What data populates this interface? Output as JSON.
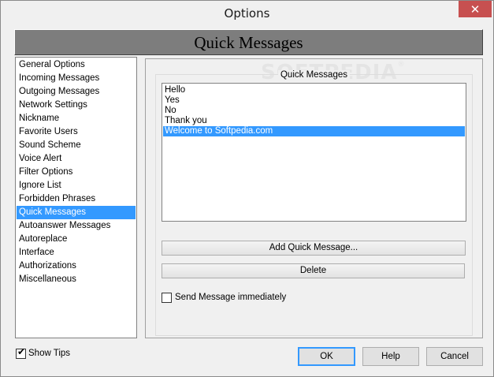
{
  "window": {
    "title": "Options",
    "close_glyph": "✕"
  },
  "header": {
    "title": "Quick Messages"
  },
  "watermark": {
    "text": "SOFTPEDIA",
    "mark": "®"
  },
  "nav": {
    "items": [
      {
        "label": "General Options"
      },
      {
        "label": "Incoming Messages"
      },
      {
        "label": "Outgoing Messages"
      },
      {
        "label": "Network Settings"
      },
      {
        "label": "Nickname"
      },
      {
        "label": "Favorite Users"
      },
      {
        "label": "Sound Scheme"
      },
      {
        "label": "Voice Alert"
      },
      {
        "label": "Filter Options"
      },
      {
        "label": "Ignore List"
      },
      {
        "label": "Forbidden Phrases"
      },
      {
        "label": "Quick Messages",
        "selected": true
      },
      {
        "label": "Autoanswer Messages"
      },
      {
        "label": "Autoreplace"
      },
      {
        "label": "Interface"
      },
      {
        "label": "Authorizations"
      },
      {
        "label": "Miscellaneous"
      }
    ]
  },
  "quick_messages": {
    "group_label": "Quick Messages",
    "messages": [
      {
        "text": "Hello"
      },
      {
        "text": "Yes"
      },
      {
        "text": "No"
      },
      {
        "text": "Thank you"
      },
      {
        "text": "Welcome to Softpedia.com",
        "selected": true
      }
    ],
    "add_label": "Add Quick Message...",
    "delete_label": "Delete",
    "send_immediately": {
      "label": "Send Message immediately",
      "checked": false
    }
  },
  "footer": {
    "show_tips": {
      "label": "Show Tips",
      "checked": true,
      "check_glyph": "✔"
    },
    "ok_label": "OK",
    "help_label": "Help",
    "cancel_label": "Cancel"
  }
}
